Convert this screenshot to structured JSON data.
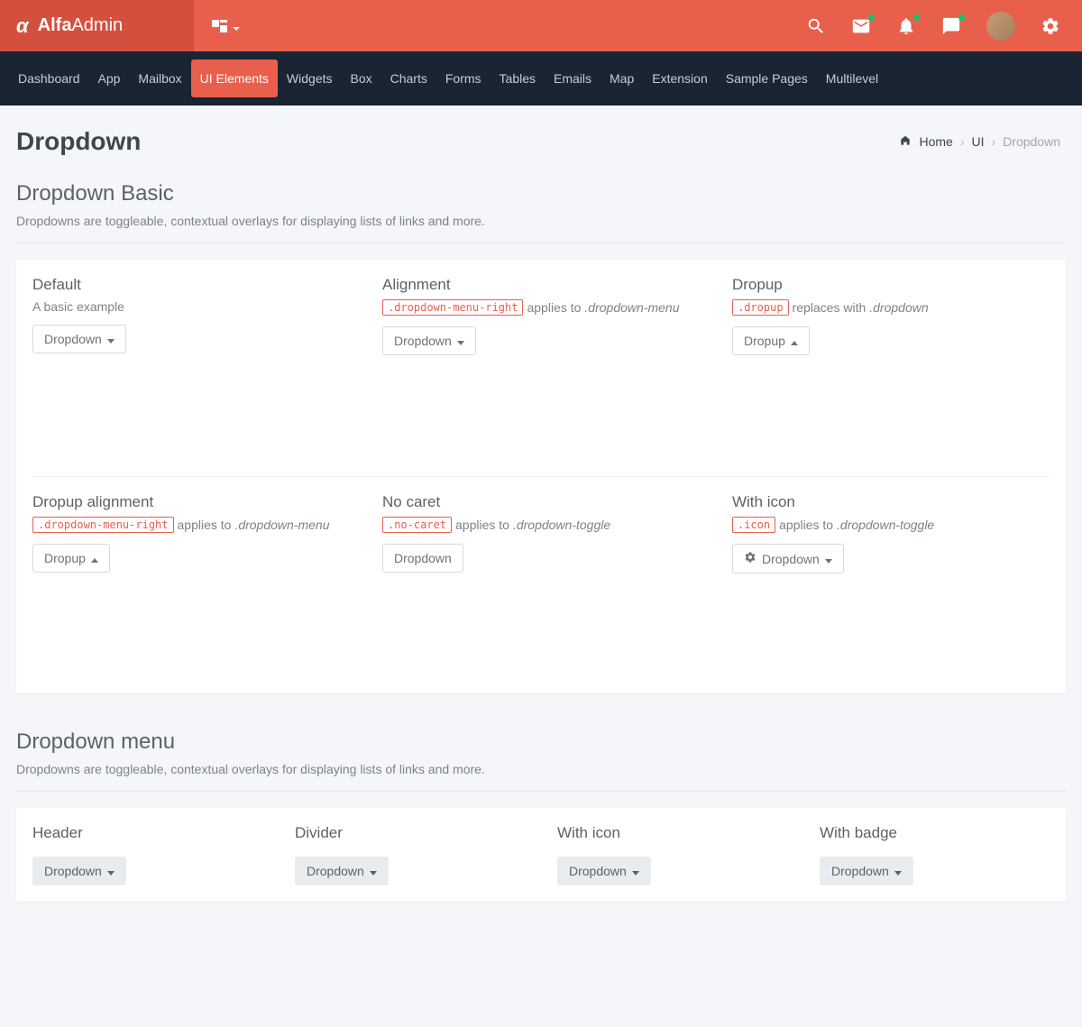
{
  "brand": {
    "bold": "Alfa",
    "light": "Admin"
  },
  "nav": [
    {
      "label": "Dashboard",
      "active": false
    },
    {
      "label": "App",
      "active": false
    },
    {
      "label": "Mailbox",
      "active": false
    },
    {
      "label": "UI Elements",
      "active": true
    },
    {
      "label": "Widgets",
      "active": false
    },
    {
      "label": "Box",
      "active": false
    },
    {
      "label": "Charts",
      "active": false
    },
    {
      "label": "Forms",
      "active": false
    },
    {
      "label": "Tables",
      "active": false
    },
    {
      "label": "Emails",
      "active": false
    },
    {
      "label": "Map",
      "active": false
    },
    {
      "label": "Extension",
      "active": false
    },
    {
      "label": "Sample Pages",
      "active": false
    },
    {
      "label": "Multilevel",
      "active": false
    }
  ],
  "page": {
    "title": "Dropdown"
  },
  "breadcrumb": {
    "home": "Home",
    "ui": "UI",
    "current": "Dropdown"
  },
  "sections": {
    "basic": {
      "title": "Dropdown Basic",
      "desc": "Dropdowns are toggleable, contextual overlays for displaying lists of links and more.",
      "items": [
        {
          "title": "Default",
          "desc_plain": "A basic example",
          "btn": "Dropdown",
          "caret": "down"
        },
        {
          "title": "Alignment",
          "code": ".dropdown-menu-right",
          "desc_mid": "applies to",
          "desc_em": ".dropdown-menu",
          "btn": "Dropdown",
          "caret": "down"
        },
        {
          "title": "Dropup",
          "code": ".dropup",
          "desc_mid": "replaces with",
          "desc_em": ".dropdown",
          "btn": "Dropup",
          "caret": "up"
        },
        {
          "title": "Dropup alignment",
          "code": ".dropdown-menu-right",
          "desc_mid": "applies to",
          "desc_em": ".dropdown-menu",
          "btn": "Dropup",
          "caret": "up"
        },
        {
          "title": "No caret",
          "code": ".no-caret",
          "desc_mid": "applies to",
          "desc_em": ".dropdown-toggle",
          "btn": "Dropdown",
          "caret": "none"
        },
        {
          "title": "With icon",
          "code": ".icon",
          "desc_mid": "applies to",
          "desc_em": ".dropdown-toggle",
          "btn": "Dropdown",
          "caret": "down",
          "icon": true
        }
      ]
    },
    "menu": {
      "title": "Dropdown menu",
      "desc": "Dropdowns are toggleable, contextual overlays for displaying lists of links and more.",
      "items": [
        {
          "title": "Header",
          "btn": "Dropdown"
        },
        {
          "title": "Divider",
          "btn": "Dropdown"
        },
        {
          "title": "With icon",
          "btn": "Dropdown"
        },
        {
          "title": "With badge",
          "btn": "Dropdown"
        }
      ]
    }
  }
}
